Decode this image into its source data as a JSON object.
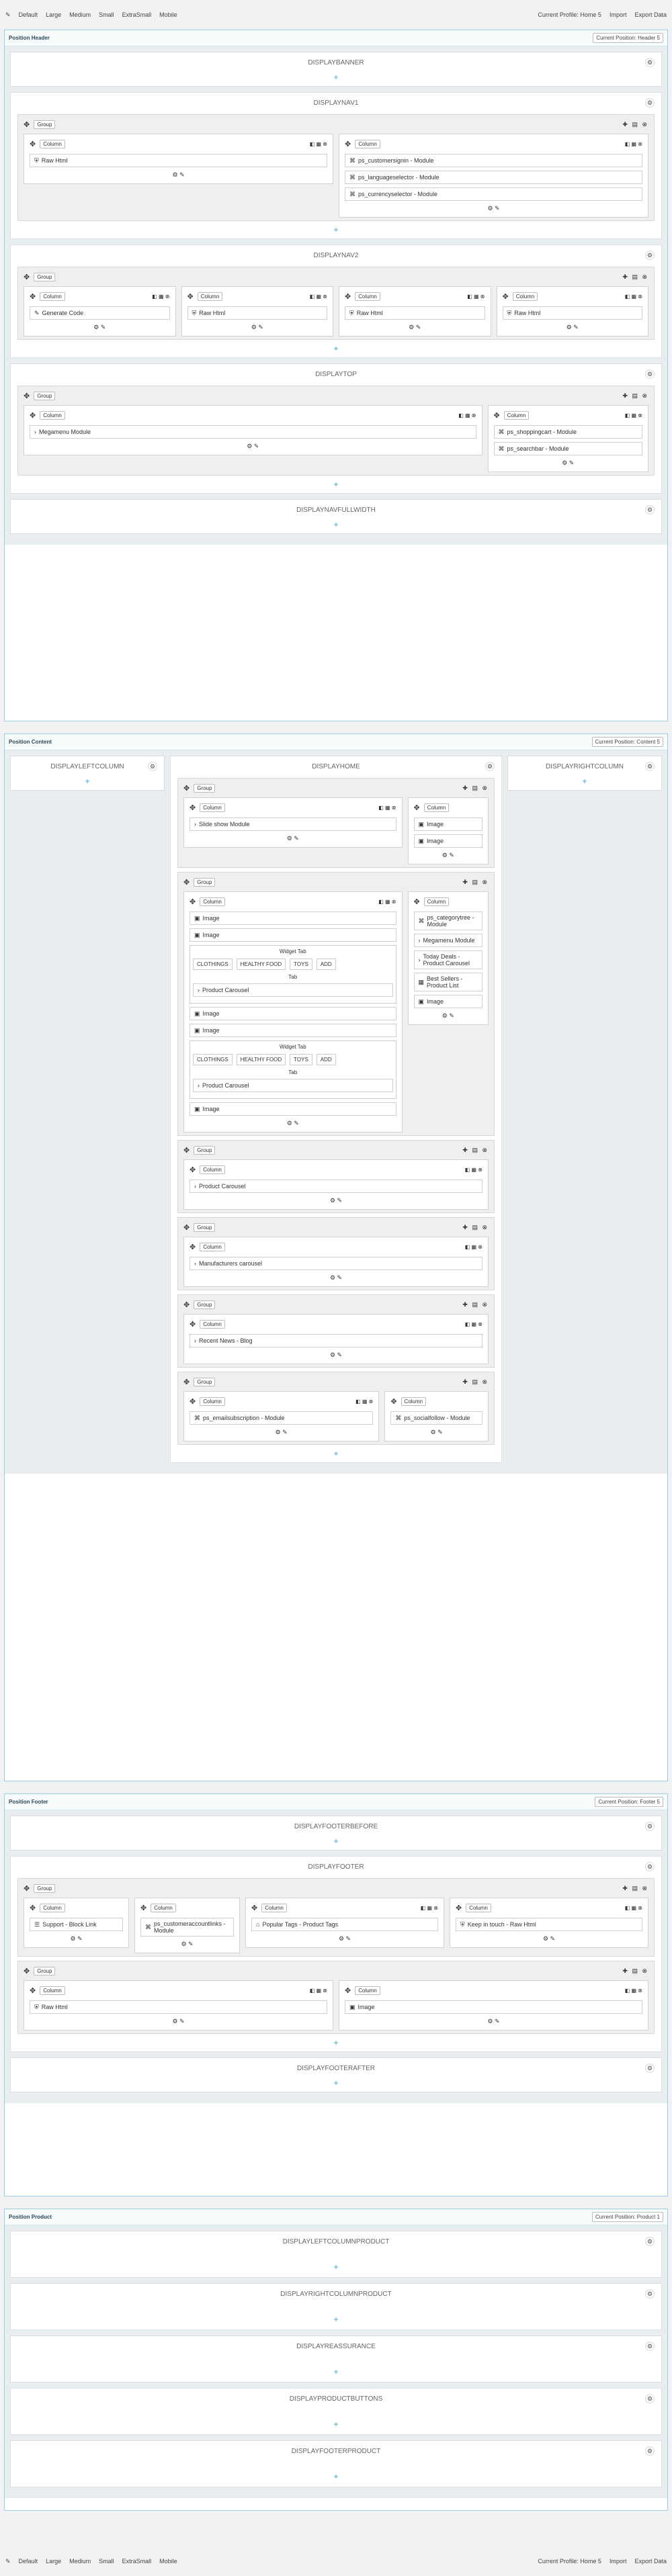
{
  "toolbar": {
    "devices": [
      "Default",
      "Large",
      "Medium",
      "Small",
      "ExtraSmall",
      "Mobile"
    ],
    "profile": "Current Profile: Home 5",
    "import": "Import",
    "export": "Export Data"
  },
  "common": {
    "add": "+",
    "group": "Group",
    "column": "Column",
    "tools": "⚙ ✎",
    "group_actions": "✚ ▤ ⊗",
    "col_actions": "◧ ▦ ⊗"
  },
  "header": {
    "title": "Position Header",
    "current": "Current Position: Header 5",
    "hooks": [
      "DISPLAYBANNER",
      "DISPLAYNAV1",
      "DISPLAYNAV2",
      "DISPLAYTOP",
      "DISPLAYNAVFULLWIDTH"
    ],
    "nav1": [
      [
        "Raw Html"
      ],
      [
        "ps_customersignin - Module",
        "ps_languageselector - Module",
        "ps_currencyselector - Module"
      ]
    ],
    "nav2": [
      [
        "Generate Code"
      ],
      [
        "Raw Html"
      ],
      [
        "Raw Html"
      ],
      [
        "Raw Html"
      ]
    ],
    "top": [
      [
        "Megamenu Module"
      ],
      [
        "ps_shoppingcart - Module",
        "ps_searchbar - Module"
      ]
    ]
  },
  "content": {
    "title": "Position Content",
    "current": "Current Position: Content 5",
    "left": "DISPLAYLEFTCOLUMN",
    "home": "DISPLAYHOME",
    "right": "DISPLAYRIGHTCOLUMN",
    "g1": [
      [
        "Slide show Module"
      ],
      [
        "Image",
        "Image"
      ]
    ],
    "g2a": [
      "Image",
      "Image"
    ],
    "widget": "Widget Tab",
    "tabs": [
      "CLOTHINGS",
      "HEALTHY FOOD",
      "TOYS",
      "ADD"
    ],
    "tab_label": "Tab",
    "carousel": "Product Carousel",
    "g2b": [
      "Image",
      "Image"
    ],
    "g2c": [
      "Image"
    ],
    "g2r": [
      "ps_categorytree - Module",
      "Megamenu Module",
      "Today Deals - Product Carousel",
      "Best Sellers - Product List",
      "Image"
    ],
    "g3": "Product Carousel",
    "g4": "Manufacturers carousel",
    "g5": "Recent News - Blog",
    "g6": [
      [
        "ps_emailsubscription - Module"
      ],
      [
        "ps_socialfollow - Module"
      ]
    ]
  },
  "footer": {
    "title": "Position Footer",
    "current": "Current Position: Footer 5",
    "hooks": [
      "DISPLAYFOOTERBEFORE",
      "DISPLAYFOOTER",
      "DISPLAYFOOTERAFTER"
    ],
    "row1": [
      [
        "Support - Block Link"
      ],
      [
        "ps_customeraccountlinks - Module"
      ],
      [
        "Popular Tags - Product Tags"
      ],
      [
        "Keep in touch - Raw Html"
      ]
    ],
    "row2": [
      [
        "Raw Html"
      ],
      [
        "Image"
      ]
    ]
  },
  "product": {
    "title": "Position Product",
    "current": "Current Position: Product 1",
    "hooks": [
      "DISPLAYLEFTCOLUMNPRODUCT",
      "DISPLAYRIGHTCOLUMNPRODUCT",
      "DISPLAYREASSURANCE",
      "DISPLAYPRODUCTBUTTONS",
      "DISPLAYFOOTERPRODUCT"
    ]
  }
}
